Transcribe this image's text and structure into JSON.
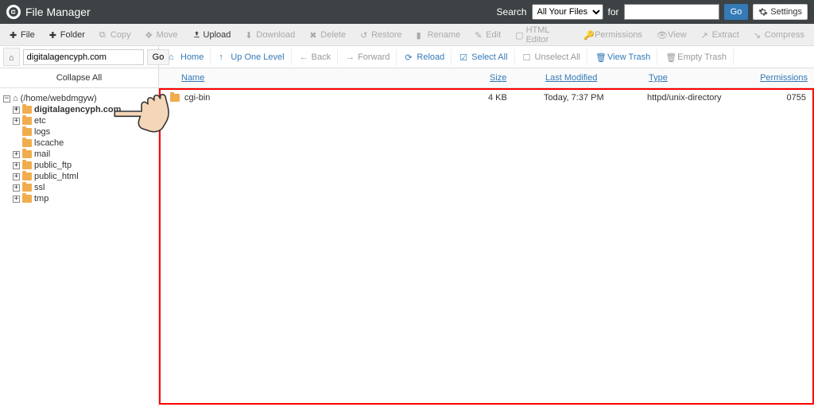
{
  "app": {
    "title": "File Manager"
  },
  "header": {
    "searchLabel": "Search",
    "searchScope": "All Your Files",
    "forLabel": "for",
    "go": "Go",
    "settings": "Settings"
  },
  "toolbar": {
    "file": "File",
    "folder": "Folder",
    "copy": "Copy",
    "move": "Move",
    "upload": "Upload",
    "download": "Download",
    "delete": "Delete",
    "restore": "Restore",
    "rename": "Rename",
    "edit": "Edit",
    "htmlEditor": "HTML Editor",
    "permissions": "Permissions",
    "view": "View",
    "extract": "Extract",
    "compress": "Compress"
  },
  "nav": {
    "path": "digitalagencyph.com",
    "go": "Go",
    "home": "Home",
    "up": "Up One Level",
    "back": "Back",
    "forward": "Forward",
    "reload": "Reload",
    "selectAll": "Select All",
    "unselectAll": "Unselect All",
    "viewTrash": "View Trash",
    "emptyTrash": "Empty Trash"
  },
  "sidebar": {
    "collapseAll": "Collapse All",
    "root": "(/home/webdmgyw)",
    "items": [
      {
        "label": "digitalagencyph.com",
        "bold": true,
        "toggle": "+"
      },
      {
        "label": "etc",
        "toggle": "+"
      },
      {
        "label": "logs",
        "toggle": ""
      },
      {
        "label": "lscache",
        "toggle": ""
      },
      {
        "label": "mail",
        "toggle": "+"
      },
      {
        "label": "public_ftp",
        "toggle": "+"
      },
      {
        "label": "public_html",
        "toggle": "+"
      },
      {
        "label": "ssl",
        "toggle": "+"
      },
      {
        "label": "tmp",
        "toggle": "+"
      }
    ]
  },
  "table": {
    "headers": {
      "name": "Name",
      "size": "Size",
      "modified": "Last Modified",
      "type": "Type",
      "permissions": "Permissions"
    },
    "rows": [
      {
        "name": "cgi-bin",
        "size": "4 KB",
        "modified": "Today, 7:37 PM",
        "type": "httpd/unix-directory",
        "permissions": "0755"
      }
    ]
  }
}
